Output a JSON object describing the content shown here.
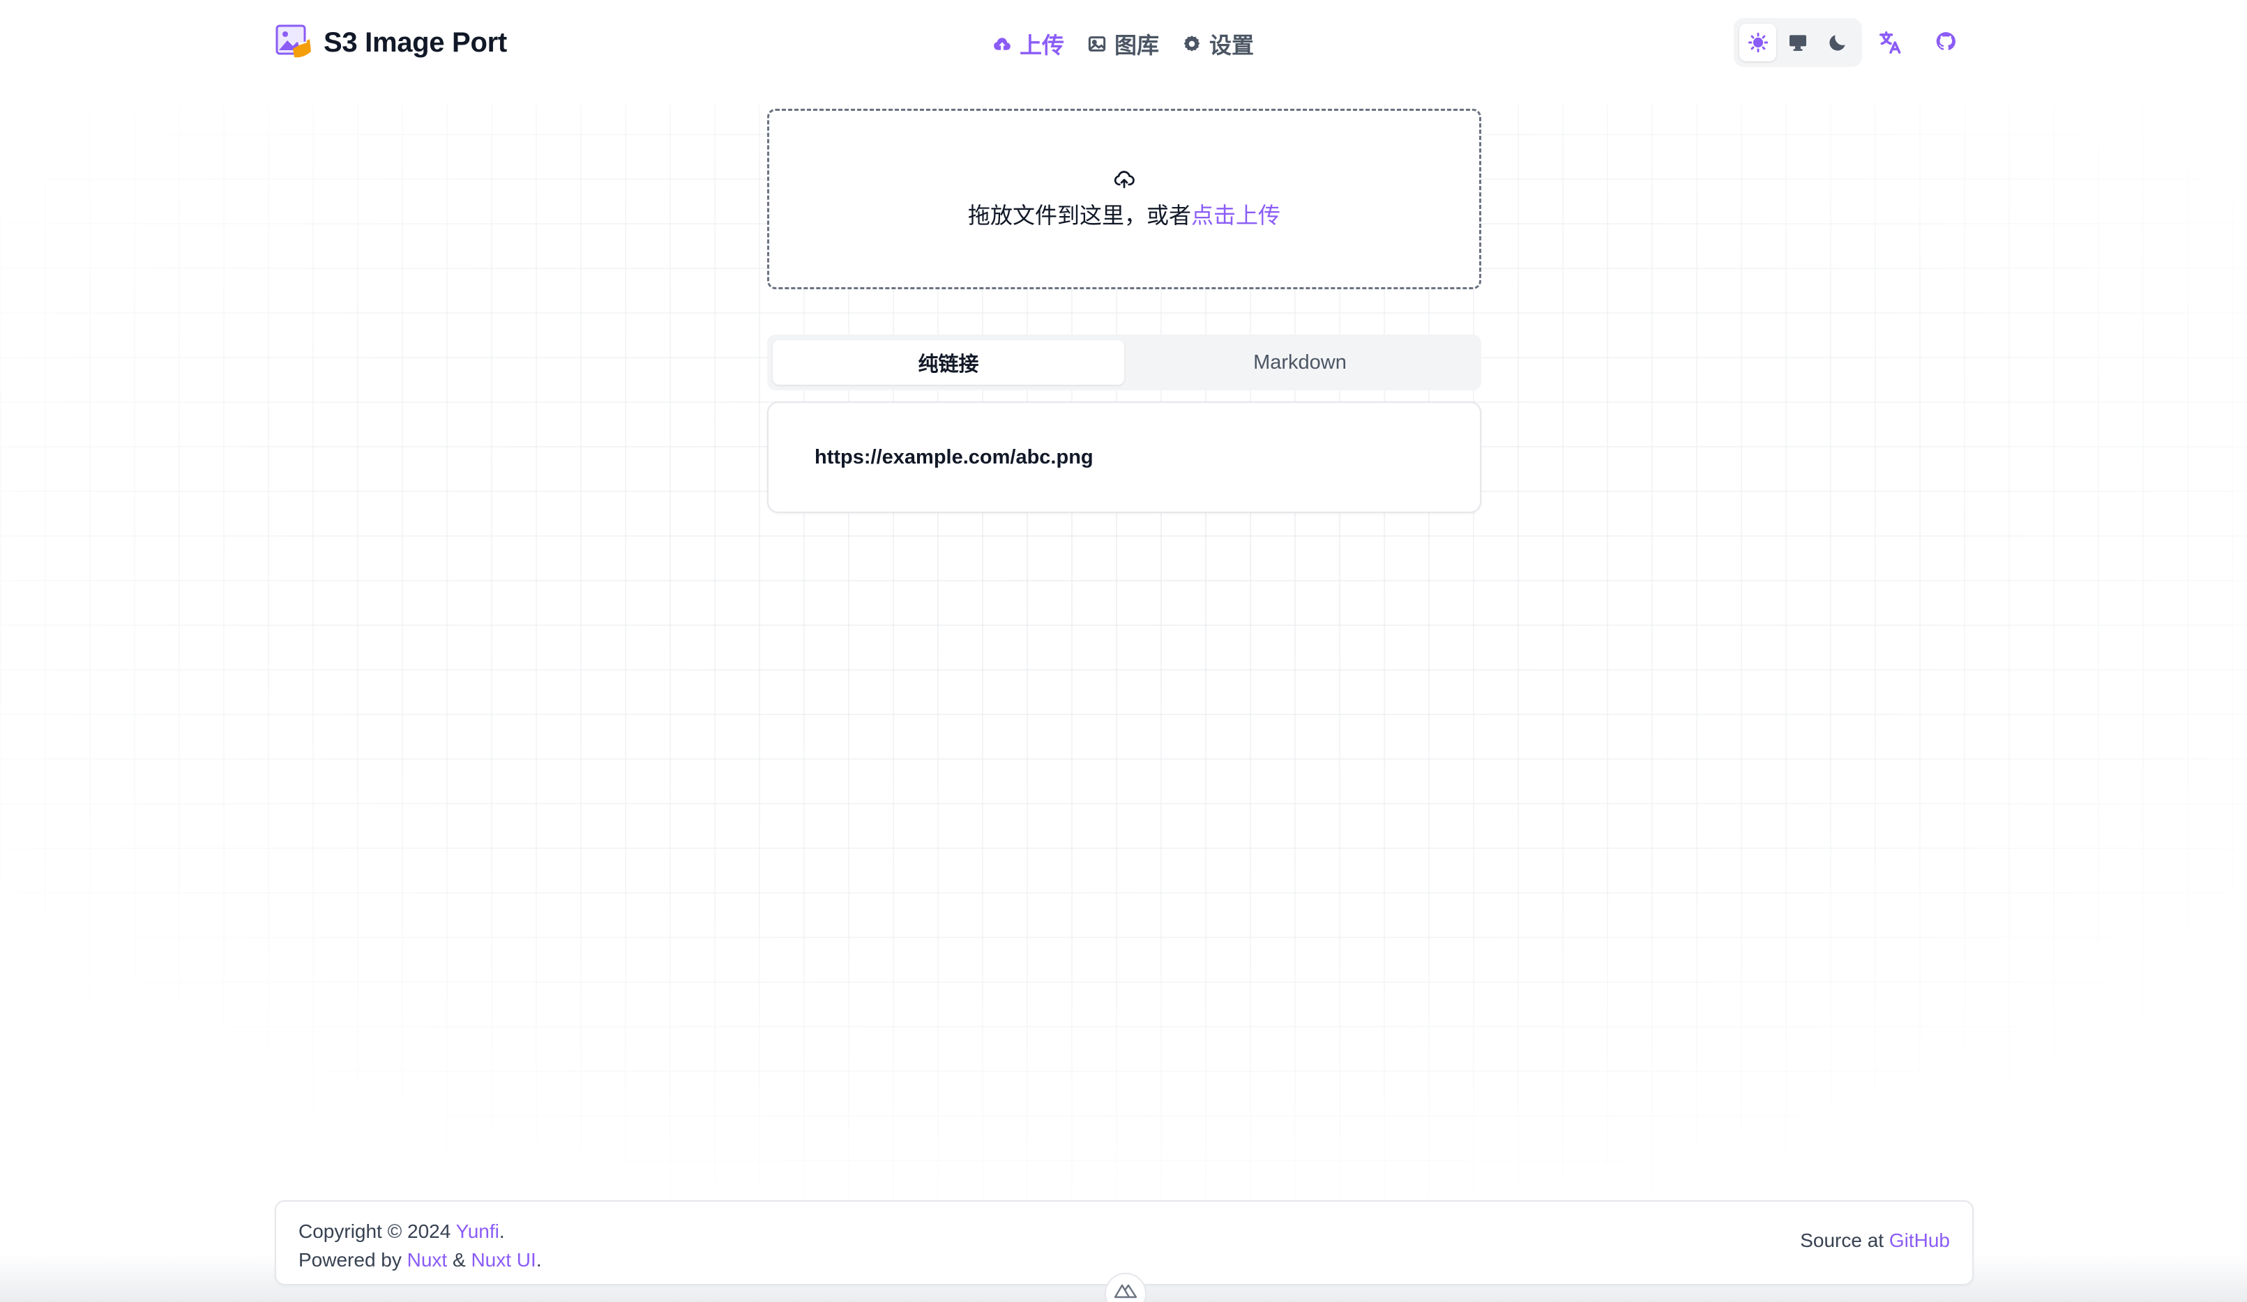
{
  "app": {
    "title": "S3 Image Port",
    "accent_color": "#8b5cf6"
  },
  "nav": {
    "items": [
      {
        "label": "上传",
        "icon": "upload-cloud-icon",
        "active": true
      },
      {
        "label": "图库",
        "icon": "image-icon",
        "active": false
      },
      {
        "label": "设置",
        "icon": "gear-icon",
        "active": false
      }
    ]
  },
  "theme_switch": {
    "options": [
      {
        "name": "light",
        "icon": "sun-icon",
        "active": true
      },
      {
        "name": "system",
        "icon": "monitor-icon",
        "active": false
      },
      {
        "name": "dark",
        "icon": "moon-icon",
        "active": false
      }
    ]
  },
  "header_actions": {
    "translate_icon": "translate-icon",
    "github_icon": "github-icon"
  },
  "upload": {
    "prompt": "拖放文件到这里，或者",
    "link_label": "点击上传",
    "icon": "upload-cloud-icon"
  },
  "result_tabs": {
    "tabs": [
      {
        "label": "纯链接",
        "active": true
      },
      {
        "label": "Markdown",
        "active": false
      }
    ]
  },
  "result": {
    "url": "https://example.com/abc.png"
  },
  "footer": {
    "copyright_prefix": "Copyright © 2024 ",
    "author": "Yunfi",
    "period1": ".",
    "powered_prefix": "Powered by ",
    "nuxt": "Nuxt",
    "amp": " & ",
    "nuxt_ui": "Nuxt UI",
    "period2": ".",
    "source_prefix": "Source at ",
    "github": "GitHub"
  }
}
